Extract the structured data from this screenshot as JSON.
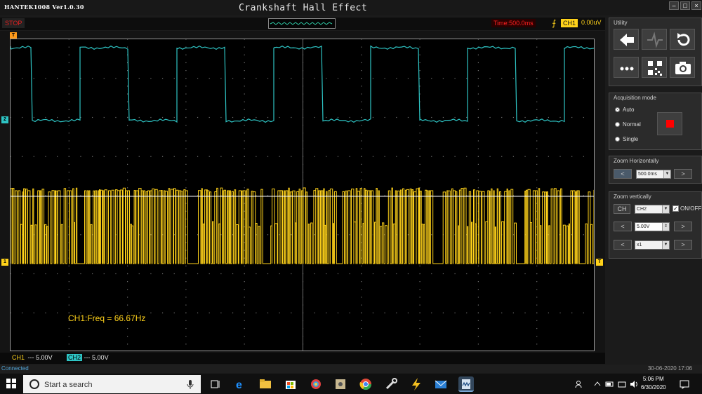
{
  "title_bar": {
    "app_name": "HANTEK1008 Ver1.0.30",
    "window_title": "Crankshaft Hall Effect",
    "controls": [
      "minimize-icon",
      "maximize-icon",
      "close-icon"
    ]
  },
  "top_bar": {
    "run_status": "STOP",
    "timebase": "Time:500.0ms",
    "trigger_channel": "CH1",
    "trigger_level": "0.00uV"
  },
  "screen": {
    "measurement": "CH1:Freq = 66.67Hz",
    "channel_markers": {
      "ch1": "1",
      "ch2": "2",
      "trigger": "T"
    },
    "grid": {
      "columns": 10,
      "rows": 8,
      "minor_per_division": 5
    },
    "channels": {
      "ch1": {
        "color": "#ffd21a",
        "waveform": "dense digital pulse train, 0–5V"
      },
      "ch2": {
        "color": "#2ec4c4",
        "waveform": "square wave"
      }
    }
  },
  "channel_bar": {
    "ch1_label": "CH1",
    "ch1_coupling": "---",
    "ch1_scale": "5.00V",
    "ch2_label": "CH2",
    "ch2_coupling": "---",
    "ch2_scale": "5.00V"
  },
  "status_line": {
    "connection": "Connected",
    "timestamp": "30-06-2020 17:06"
  },
  "panel": {
    "utility": {
      "title": "Utility",
      "buttons": [
        "back-arrow-icon",
        "waveform-icon",
        "refresh-icon",
        "more-icon",
        "qr-code-icon",
        "camera-icon"
      ]
    },
    "acquisition": {
      "title": "Acquisition mode",
      "options": [
        "Auto",
        "Normal",
        "Single"
      ],
      "selected": "Auto",
      "stop_button_color": "#ff0000"
    },
    "zoom_horizontal": {
      "title": "Zoom Horizontally",
      "value": "500.0ms"
    },
    "zoom_vertical": {
      "title": "Zoom vertically",
      "ch_button": "CH",
      "channel": "CH2",
      "on_off_label": "ON/OFF",
      "on_off_checked": true,
      "volts_div": "5.00V",
      "probe": "x1"
    }
  },
  "taskbar": {
    "search_placeholder": "Start a search",
    "clock_time": "5:06 PM",
    "clock_date": "6/30/2020",
    "apps": [
      "task-view-icon",
      "edge-icon",
      "file-explorer-icon",
      "store-icon",
      "picasa-icon",
      "app-icon",
      "chrome-icon",
      "tools-icon",
      "power-icon",
      "mail-icon",
      "hantek-icon"
    ]
  },
  "colors": {
    "ch1": "#ffd21a",
    "ch2": "#2ec4c4",
    "stop_red": "#e02020",
    "grid": "#707070"
  }
}
